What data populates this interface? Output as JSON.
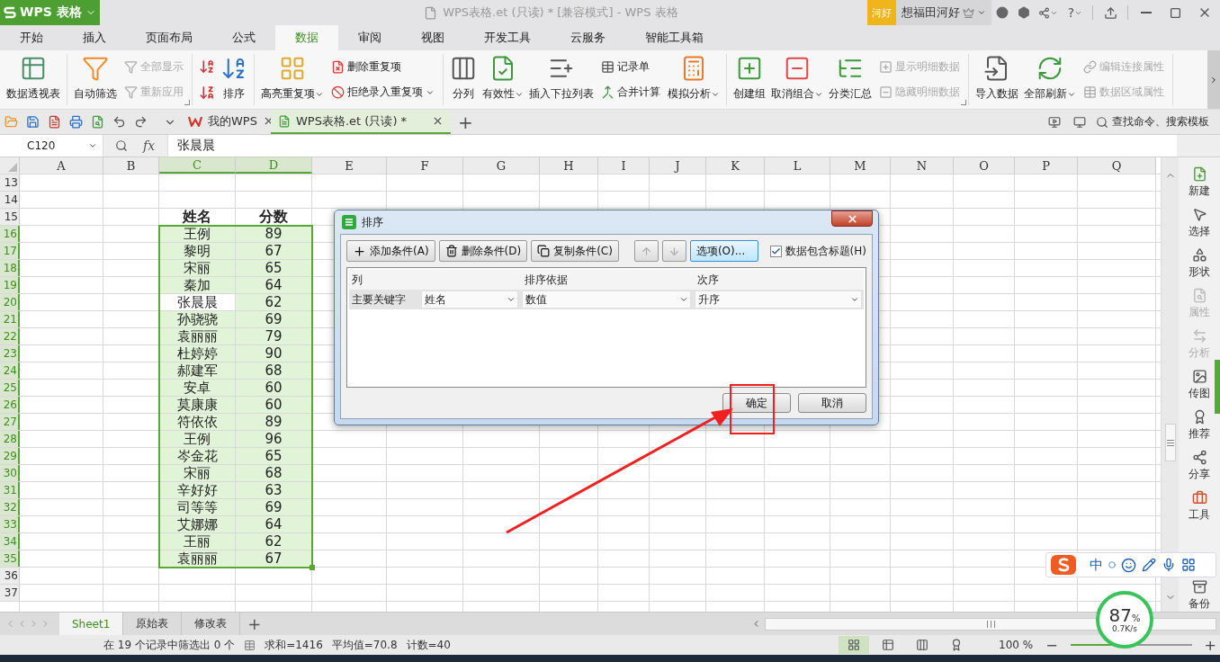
{
  "title_bar": {
    "app_name": "WPS 表格",
    "document_title": "WPS表格.et (只读) * [兼容模式] - WPS 表格",
    "user_badge": "河好",
    "user_name": "想福田河好",
    "help": "?"
  },
  "menu_tabs": [
    {
      "label": "开始",
      "selected": false
    },
    {
      "label": "插入",
      "selected": false
    },
    {
      "label": "页面布局",
      "selected": false
    },
    {
      "label": "公式",
      "selected": false
    },
    {
      "label": "数据",
      "selected": true
    },
    {
      "label": "审阅",
      "selected": false
    },
    {
      "label": "视图",
      "selected": false
    },
    {
      "label": "开发工具",
      "selected": false
    },
    {
      "label": "云服务",
      "selected": false
    },
    {
      "label": "智能工具箱",
      "selected": false
    }
  ],
  "ribbon": {
    "groups": [
      {
        "launcher": false,
        "items": [
          {
            "kind": "large",
            "label": "数据透视表",
            "dropdown": false,
            "disabled": false
          }
        ]
      },
      {
        "launcher": true,
        "items": [
          {
            "kind": "large",
            "label": "自动筛选",
            "dropdown": false,
            "disabled": false
          },
          {
            "kind": "stack",
            "items": [
              {
                "label": "全部显示",
                "dropdown": false,
                "disabled": true
              },
              {
                "label": "重新应用",
                "dropdown": false,
                "disabled": true
              }
            ]
          }
        ]
      },
      {
        "launcher": false,
        "items": [
          {
            "kind": "sort_icons"
          },
          {
            "kind": "large",
            "label": "排序",
            "dropdown": false,
            "disabled": false
          }
        ]
      },
      {
        "launcher": false,
        "items": [
          {
            "kind": "large",
            "label": "高亮重复项",
            "dropdown": true,
            "disabled": false
          },
          {
            "kind": "stack",
            "items": [
              {
                "label": "删除重复项",
                "dropdown": false,
                "disabled": false
              },
              {
                "label": "拒绝录入重复项",
                "dropdown": true,
                "disabled": false
              }
            ]
          }
        ]
      },
      {
        "launcher": false,
        "items": [
          {
            "kind": "large",
            "label": "分列",
            "dropdown": false,
            "disabled": false
          },
          {
            "kind": "large",
            "label": "有效性",
            "dropdown": true,
            "disabled": false
          },
          {
            "kind": "large",
            "label": "插入下拉列表",
            "dropdown": false,
            "disabled": false
          },
          {
            "kind": "stack",
            "items": [
              {
                "label": "记录单",
                "dropdown": false,
                "disabled": false
              },
              {
                "label": "合并计算",
                "dropdown": false,
                "disabled": false
              }
            ]
          },
          {
            "kind": "large",
            "label": "模拟分析",
            "dropdown": true,
            "disabled": false
          }
        ]
      },
      {
        "launcher": true,
        "items": [
          {
            "kind": "large",
            "label": "创建组",
            "dropdown": false,
            "disabled": false
          },
          {
            "kind": "large",
            "label": "取消组合",
            "dropdown": true,
            "disabled": false
          },
          {
            "kind": "large",
            "label": "分类汇总",
            "dropdown": false,
            "disabled": false
          },
          {
            "kind": "stack",
            "items": [
              {
                "label": "显示明细数据",
                "dropdown": false,
                "disabled": true
              },
              {
                "label": "隐藏明细数据",
                "dropdown": false,
                "disabled": true
              }
            ]
          }
        ]
      },
      {
        "launcher": false,
        "items": [
          {
            "kind": "large",
            "label": "导入数据",
            "dropdown": false,
            "disabled": false
          },
          {
            "kind": "large",
            "label": "全部刷新",
            "dropdown": true,
            "disabled": false
          },
          {
            "kind": "stack",
            "items": [
              {
                "label": "编辑连接属性",
                "dropdown": false,
                "disabled": true
              },
              {
                "label": "数据区域属性",
                "dropdown": false,
                "disabled": true
              }
            ]
          }
        ]
      }
    ]
  },
  "doc_bar": {
    "tabs": [
      {
        "label": "我的WPS",
        "selected": false
      },
      {
        "label": "WPS表格.et (只读) *",
        "selected": true
      }
    ],
    "new_tab": "+",
    "search": "查找命令、搜索模板"
  },
  "formula_bar": {
    "cell_reference": "C120",
    "function_label": "fx",
    "value": "张晨晨"
  },
  "sheet": {
    "columns": [
      {
        "label": "A",
        "selected": false
      },
      {
        "label": "B",
        "selected": false
      },
      {
        "label": "C",
        "selected": true
      },
      {
        "label": "D",
        "selected": true
      },
      {
        "label": "E",
        "selected": false
      },
      {
        "label": "F",
        "selected": false
      },
      {
        "label": "G",
        "selected": false
      },
      {
        "label": "H",
        "selected": false
      },
      {
        "label": "I",
        "selected": false
      },
      {
        "label": "J",
        "selected": false
      },
      {
        "label": "K",
        "selected": false
      },
      {
        "label": "L",
        "selected": false
      },
      {
        "label": "M",
        "selected": false
      },
      {
        "label": "N",
        "selected": false
      },
      {
        "label": "O",
        "selected": false
      },
      {
        "label": "P",
        "selected": false
      },
      {
        "label": "Q",
        "selected": false
      }
    ],
    "rows": [
      {
        "number": "13",
        "kind": "blank",
        "selected": false
      },
      {
        "number": "14",
        "kind": "blank",
        "selected": false
      },
      {
        "number": "15",
        "kind": "header",
        "selected": false,
        "cells": [
          "姓名",
          "分数"
        ]
      },
      {
        "number": "16",
        "kind": "data",
        "selected": true,
        "cells": [
          "王例",
          "89"
        ]
      },
      {
        "number": "17",
        "kind": "data",
        "selected": true,
        "cells": [
          "黎明",
          "67"
        ]
      },
      {
        "number": "18",
        "kind": "data",
        "selected": true,
        "cells": [
          "宋丽",
          "65"
        ]
      },
      {
        "number": "19",
        "kind": "data",
        "selected": true,
        "cells": [
          "秦加",
          "64"
        ]
      },
      {
        "number": "20",
        "kind": "current",
        "selected": true,
        "cells": [
          "张晨晨",
          "62"
        ]
      },
      {
        "number": "21",
        "kind": "data",
        "selected": true,
        "cells": [
          "孙骁骁",
          "69"
        ]
      },
      {
        "number": "22",
        "kind": "data",
        "selected": true,
        "cells": [
          "袁丽丽",
          "79"
        ]
      },
      {
        "number": "23",
        "kind": "data",
        "selected": true,
        "cells": [
          "杜婷婷",
          "90"
        ]
      },
      {
        "number": "24",
        "kind": "data",
        "selected": true,
        "cells": [
          "郝建军",
          "68"
        ]
      },
      {
        "number": "25",
        "kind": "data",
        "selected": true,
        "cells": [
          "安卓",
          "60"
        ]
      },
      {
        "number": "26",
        "kind": "data",
        "selected": true,
        "cells": [
          "莫康康",
          "60"
        ]
      },
      {
        "number": "27",
        "kind": "data",
        "selected": true,
        "cells": [
          "符依依",
          "89"
        ]
      },
      {
        "number": "28",
        "kind": "data",
        "selected": true,
        "cells": [
          "王例",
          "96"
        ]
      },
      {
        "number": "29",
        "kind": "data",
        "selected": true,
        "cells": [
          "岑金花",
          "65"
        ]
      },
      {
        "number": "30",
        "kind": "data",
        "selected": true,
        "cells": [
          "宋丽",
          "68"
        ]
      },
      {
        "number": "31",
        "kind": "data",
        "selected": true,
        "cells": [
          "辛好好",
          "63"
        ]
      },
      {
        "number": "32",
        "kind": "data",
        "selected": true,
        "cells": [
          "司等等",
          "69"
        ]
      },
      {
        "number": "33",
        "kind": "data",
        "selected": true,
        "cells": [
          "艾娜娜",
          "64"
        ]
      },
      {
        "number": "34",
        "kind": "data",
        "selected": true,
        "cells": [
          "王丽",
          "62"
        ]
      },
      {
        "number": "35",
        "kind": "data",
        "selected": true,
        "cells": [
          "袁丽丽",
          "67"
        ]
      },
      {
        "number": "36",
        "kind": "blank",
        "selected": false
      },
      {
        "number": "37",
        "kind": "blank",
        "selected": false
      }
    ]
  },
  "sidebar": [
    {
      "label": "新建",
      "disabled": false
    },
    {
      "label": "选择",
      "disabled": false
    },
    {
      "label": "形状",
      "disabled": false
    },
    {
      "label": "属性",
      "disabled": true
    },
    {
      "label": "分析",
      "disabled": true
    },
    {
      "label": "传图",
      "disabled": false
    },
    {
      "label": "推荐",
      "disabled": false
    },
    {
      "label": "分享",
      "disabled": false
    },
    {
      "label": "工具",
      "disabled": false
    },
    {
      "label": "备份",
      "disabled": false
    }
  ],
  "sheet_tabs": {
    "tabs": [
      {
        "label": "Sheet1",
        "selected": true
      },
      {
        "label": "原始表",
        "selected": false
      },
      {
        "label": "修改表",
        "selected": false
      }
    ],
    "add": "+"
  },
  "status_bar": {
    "filter_info": "在 19 个记录中筛选出 0 个",
    "sum": "求和=1416",
    "average": "平均值=70.8",
    "count": "计数=40",
    "zoom": "100 %",
    "zoom_out": "−",
    "zoom_in": "+",
    "zoom_slider": {
      "level": 0.42
    }
  },
  "dialog": {
    "title": "排序",
    "toolbar": [
      {
        "kind": "add",
        "label": "添加条件(A)"
      },
      {
        "kind": "delete",
        "label": "删除条件(D)"
      },
      {
        "kind": "copy",
        "label": "复制条件(C)"
      }
    ],
    "move_buttons": [
      {
        "kind": "up",
        "disabled": true
      },
      {
        "kind": "down",
        "disabled": true
      }
    ],
    "options_button": {
      "label": "选项(O)...",
      "focused": true
    },
    "header_checkbox": {
      "label": "数据包含标题(H)",
      "checked": true
    },
    "columns": [
      "列",
      "排序依据",
      "次序"
    ],
    "rows": [
      {
        "key_label": "主要关键字",
        "column": "姓名",
        "sort_on": "数值",
        "order": "升序"
      }
    ],
    "buttons": [
      "确定",
      "取消"
    ]
  },
  "ime_toolbar": {
    "mode": "中"
  },
  "network_widget": {
    "percent": "87",
    "percent_sign": "%",
    "speed": "0.7K/s"
  }
}
